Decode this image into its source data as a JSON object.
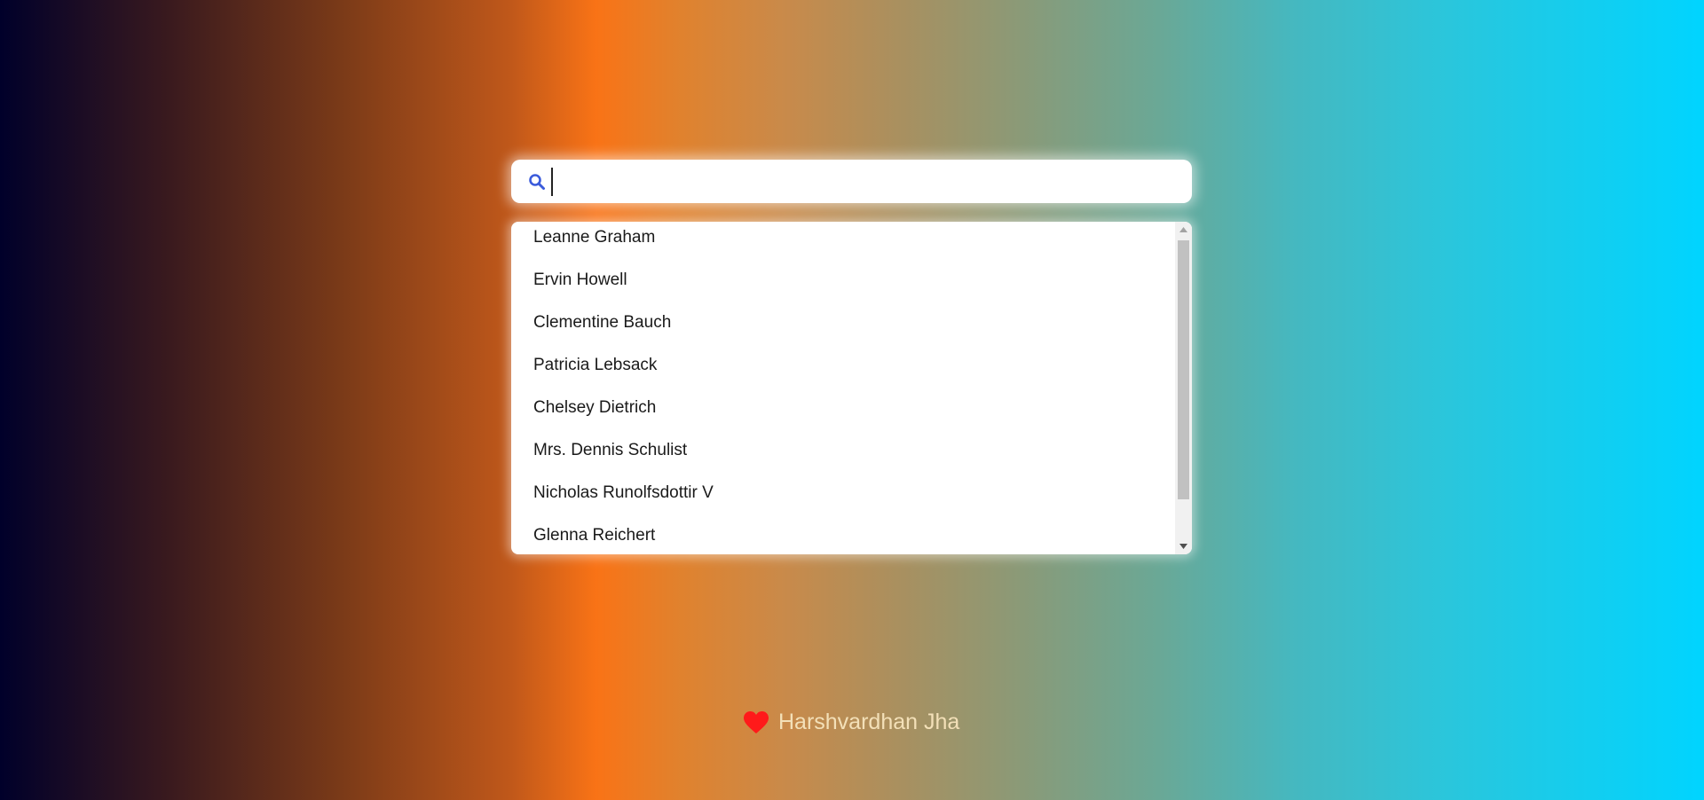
{
  "search": {
    "icon": "search-icon",
    "value": "",
    "accent_color": "#3b5bdb"
  },
  "results": {
    "items": [
      {
        "label": "Leanne Graham"
      },
      {
        "label": "Ervin Howell"
      },
      {
        "label": "Clementine Bauch"
      },
      {
        "label": "Patricia Lebsack"
      },
      {
        "label": "Chelsey Dietrich"
      },
      {
        "label": "Mrs. Dennis Schulist"
      },
      {
        "label": "Nicholas Runolfsdottir V"
      },
      {
        "label": "Glenna Reichert"
      }
    ]
  },
  "footer": {
    "icon": "heart-icon",
    "icon_color": "#ff1a1a",
    "author": "Harshvardhan Jha"
  }
}
